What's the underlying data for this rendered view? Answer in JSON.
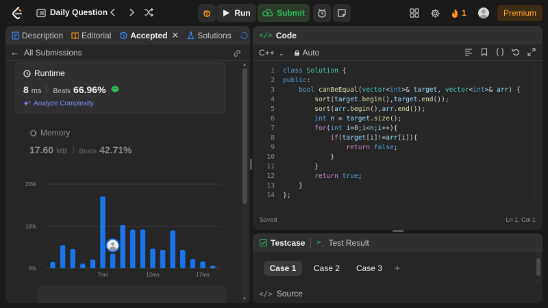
{
  "topbar": {
    "title": "Daily Question",
    "run_label": "Run",
    "submit_label": "Submit",
    "streak": "1",
    "premium_label": "Premium"
  },
  "left": {
    "tabs": [
      {
        "label": "Description"
      },
      {
        "label": "Editorial"
      },
      {
        "label": "Accepted"
      },
      {
        "label": "Solutions"
      }
    ],
    "all_submissions": "All Submissions",
    "runtime": {
      "heading": "Runtime",
      "value": "8",
      "unit": "ms",
      "beats_label": "Beats",
      "beats_value": "66.96%",
      "analyze": "Analyze Complexity"
    },
    "memory": {
      "heading": "Memory",
      "value": "17.60",
      "unit": "MB",
      "beats_label": "Beats",
      "beats_value": "42.71%"
    }
  },
  "chart_data": {
    "type": "bar",
    "y_ticks": [
      "20%",
      "10%",
      "0%"
    ],
    "ylim": [
      0,
      20
    ],
    "x_tick_labels": [
      "7ms",
      "12ms",
      "17ms"
    ],
    "values": [
      1.5,
      5.5,
      4.6,
      1.1,
      2.1,
      17.1,
      3.5,
      10.3,
      9.2,
      9.2,
      4.7,
      4.4,
      9.0,
      4.4,
      2.2,
      1.6,
      0.6
    ],
    "highlight_index": 6,
    "grid": true,
    "colors": {
      "bar": "#1c74e9",
      "grid": "#3a3a3a"
    }
  },
  "code": {
    "title": "Code",
    "language": "C++",
    "auto_label": "Auto",
    "status": "Saved",
    "cursor": "Ln 1, Col 1",
    "lines": [
      "1",
      "2",
      "3",
      "4",
      "5",
      "6",
      "7",
      "8",
      "9",
      "10",
      "11",
      "12",
      "13",
      "14"
    ]
  },
  "testcase": {
    "tab_testcase": "Testcase",
    "tab_result": "Test Result",
    "cases": [
      "Case 1",
      "Case 2",
      "Case 3"
    ],
    "add": "+",
    "source_label": "Source"
  }
}
